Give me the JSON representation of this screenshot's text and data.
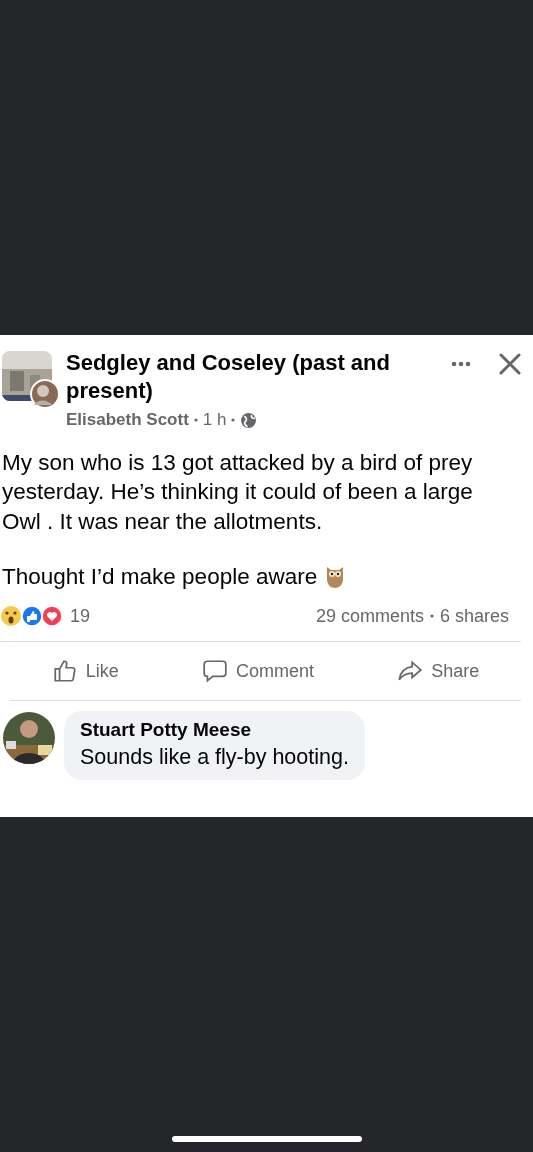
{
  "post": {
    "group": "Sedgley and Coseley (past and present)",
    "author": "Elisabeth Scott",
    "time": "1 h",
    "body": [
      "My son who is 13 got attacked by a bird of prey yesterday. He’s thinking it could of been a large Owl .  It was near the allotments.",
      "Thought I’d make people aware"
    ],
    "reactions": {
      "count": "19",
      "comments": "29 comments",
      "shares": "6 shares"
    },
    "actions": [
      {
        "kind": "like",
        "label": "Like"
      },
      {
        "kind": "comment",
        "label": "Comment"
      },
      {
        "kind": "share",
        "label": "Share"
      }
    ],
    "comment": {
      "name": "Stuart Potty Meese",
      "text": "Sounds like a fly-by hooting."
    }
  }
}
